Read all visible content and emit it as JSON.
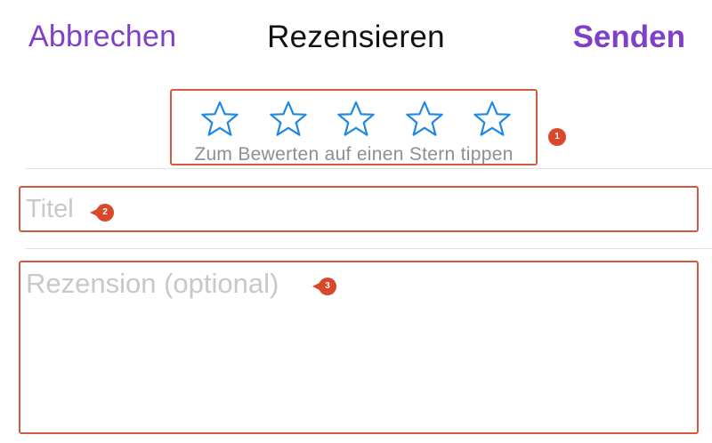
{
  "nav": {
    "cancel_label": "Abbrechen",
    "title": "Rezensieren",
    "send_label": "Senden"
  },
  "rating": {
    "star_count": 5,
    "selected": 0,
    "hint": "Zum Bewerten auf einen Stern tippen"
  },
  "form": {
    "title_placeholder": "Titel",
    "title_value": "",
    "review_placeholder": "Rezension (optional)",
    "review_value": ""
  },
  "annotations": [
    "1",
    "2",
    "3"
  ],
  "colors": {
    "accent": "#7E3FC9",
    "star": "#1E88E5",
    "annotation": "#D9482B",
    "placeholder": "#C7C7CC",
    "hint": "#8E8E93"
  }
}
